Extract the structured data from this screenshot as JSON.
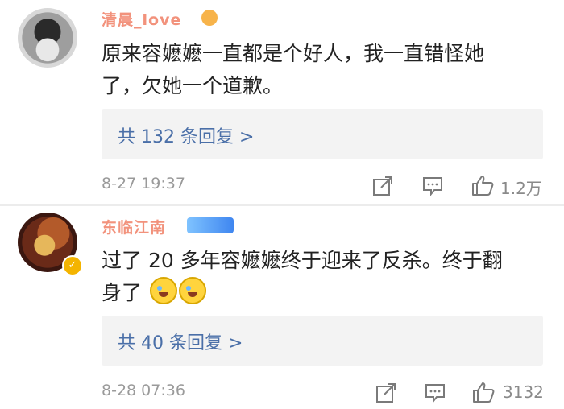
{
  "comments": [
    {
      "username": "清晨_love",
      "text_line1": "原来容嬷嬷一直都是个好人，我一直错怪她",
      "text_line2": "了，欠她一个道歉。",
      "reply_label": "共 132 条回复 >",
      "timestamp": "8-27 19:37",
      "like_count": "1.2万"
    },
    {
      "username": "东临江南",
      "text_line1": "过了 20 多年容嬷嬷终于迎来了反杀。终于翻",
      "text_line2": "身了",
      "reply_label": "共 40 条回复 >",
      "timestamp": "8-28 07:36",
      "like_count": "3132"
    }
  ],
  "icons": {
    "share": "share-icon",
    "comment": "comment-icon",
    "like": "thumbs-up-icon",
    "verified": "verified-badge-icon",
    "emoji": "crying-laughing-emoji"
  },
  "colors": {
    "username": "#f07f66",
    "reply_link": "#4a6fa8",
    "meta": "#9a9a9a"
  }
}
